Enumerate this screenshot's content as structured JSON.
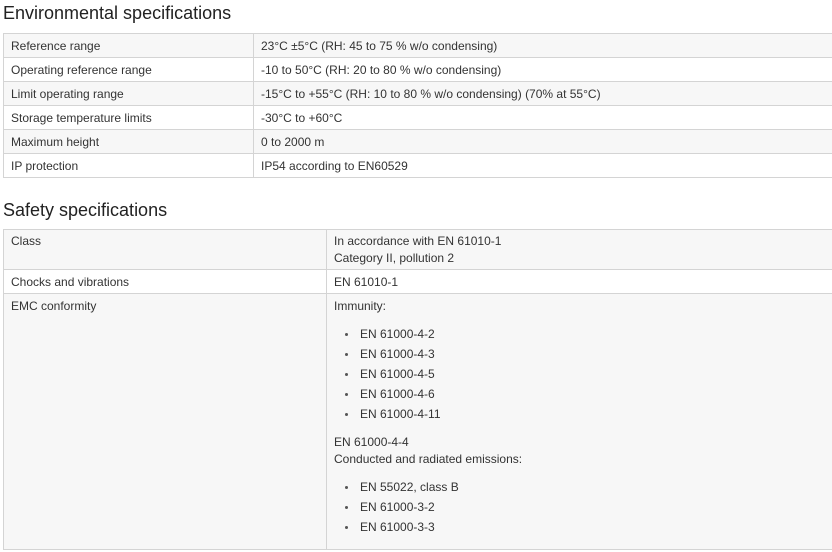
{
  "environmental": {
    "title": "Environmental specifications",
    "rows": [
      {
        "label": "Reference range",
        "value": "23°C ±5°C (RH: 45 to 75 % w/o condensing)"
      },
      {
        "label": "Operating reference range",
        "value": "-10 to 50°C (RH: 20 to 80 % w/o condensing)"
      },
      {
        "label": "Limit operating range",
        "value": "-15°C to +55°C (RH: 10 to 80 % w/o condensing) (70% at 55°C)"
      },
      {
        "label": "Storage temperature limits",
        "value": "-30°C to +60°C"
      },
      {
        "label": "Maximum height",
        "value": "0 to 2000 m"
      },
      {
        "label": "IP protection",
        "value": "IP54 according to EN60529"
      }
    ]
  },
  "safety": {
    "title": "Safety specifications",
    "class": {
      "label": "Class",
      "value_lines": [
        "In accordance with EN 61010-1",
        "Category II, pollution 2"
      ]
    },
    "chocks": {
      "label": "Chocks and vibrations",
      "value": "EN 61010-1"
    },
    "emc": {
      "label": "EMC conformity",
      "immunity_heading": "Immunity:",
      "immunity_items": [
        "EN 61000-4-2",
        "EN 61000-4-3",
        "EN 61000-4-5",
        "EN 61000-4-6",
        "EN 61000-4-11"
      ],
      "extra_line_1": "EN 61000-4-4",
      "extra_line_2": "Conducted and radiated emissions:",
      "emission_items": [
        "EN 55022, class B",
        "EN 61000-3-2",
        "EN 61000-3-3"
      ]
    }
  }
}
